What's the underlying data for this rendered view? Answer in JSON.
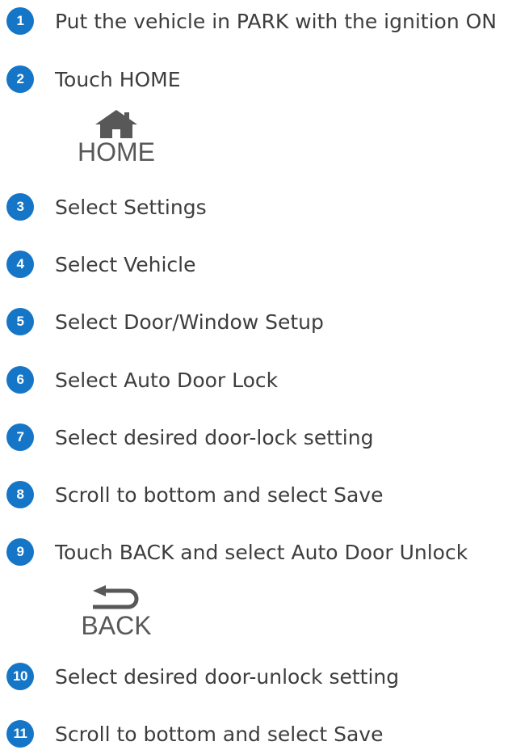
{
  "colors": {
    "badge": "#1576c7",
    "text": "#3d3d3d",
    "icon": "#585858"
  },
  "steps": [
    {
      "number": "1",
      "text": "Put the vehicle in PARK with the ignition ON"
    },
    {
      "number": "2",
      "text": "Touch HOME"
    },
    {
      "number": "3",
      "text": "Select Settings"
    },
    {
      "number": "4",
      "text": "Select Vehicle"
    },
    {
      "number": "5",
      "text": "Select Door/Window Setup"
    },
    {
      "number": "6",
      "text": "Select Auto Door Lock"
    },
    {
      "number": "7",
      "text": "Select desired door-lock setting"
    },
    {
      "number": "8",
      "text": "Scroll to bottom and select Save"
    },
    {
      "number": "9",
      "text": "Touch BACK and select Auto Door Unlock"
    },
    {
      "number": "10",
      "text": "Select desired door-unlock setting"
    },
    {
      "number": "11",
      "text": "Scroll to bottom and select Save"
    }
  ],
  "home_icon": {
    "icon": "house-icon",
    "label": "HOME"
  },
  "back_icon": {
    "icon": "return-arrow-icon",
    "label": "BACK"
  }
}
